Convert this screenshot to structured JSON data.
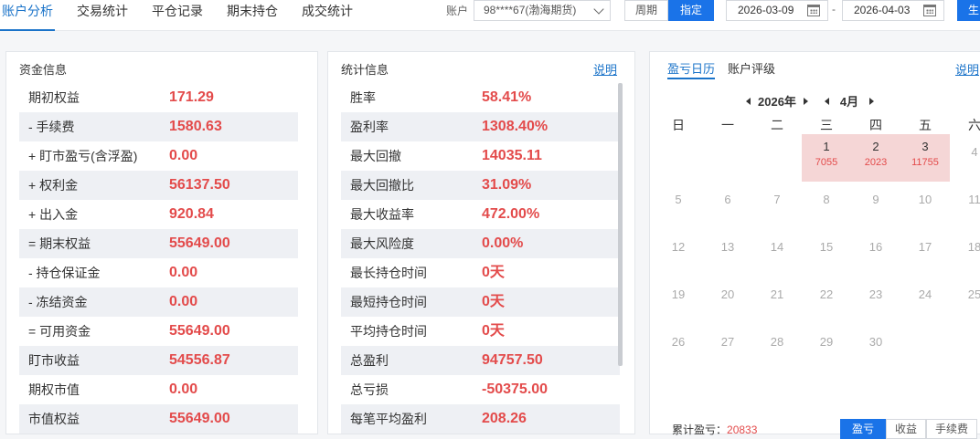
{
  "tabs": [
    "账户分析",
    "交易统计",
    "平仓记录",
    "期末持仓",
    "成交统计"
  ],
  "toolbar": {
    "account_label": "账户",
    "account_value": "98****67(渤海期货)",
    "period_label": "周期",
    "fixed_label": "指定",
    "date_start": "2026-03-09",
    "date_sep": "-",
    "date_end": "2026-04-03",
    "generate_label": "生"
  },
  "funds": {
    "title": "资金信息",
    "rows": [
      {
        "label": "期初权益",
        "value": "171.29"
      },
      {
        "label": "- 手续费",
        "value": "1580.63"
      },
      {
        "label": "+ 盯市盈亏(含浮盈)",
        "value": "0.00"
      },
      {
        "label": "+ 权利金",
        "value": "56137.50"
      },
      {
        "label": "+ 出入金",
        "value": "920.84"
      },
      {
        "label": "= 期末权益",
        "value": "55649.00"
      },
      {
        "label": "- 持仓保证金",
        "value": "0.00"
      },
      {
        "label": "- 冻结资金",
        "value": "0.00"
      },
      {
        "label": "= 可用资金",
        "value": "55649.00"
      },
      {
        "label": "盯市收益",
        "value": "54556.87"
      },
      {
        "label": "期权市值",
        "value": "0.00"
      },
      {
        "label": "市值权益",
        "value": "55649.00"
      }
    ]
  },
  "stats": {
    "title": "统计信息",
    "help": "说明",
    "rows": [
      {
        "label": "胜率",
        "value": "58.41%"
      },
      {
        "label": "盈利率",
        "value": "1308.40%"
      },
      {
        "label": "最大回撤",
        "value": "14035.11"
      },
      {
        "label": "最大回撤比",
        "value": "31.09%"
      },
      {
        "label": "最大收益率",
        "value": "472.00%"
      },
      {
        "label": "最大风险度",
        "value": "0.00%"
      },
      {
        "label": "最长持仓时间",
        "value": "0天"
      },
      {
        "label": "最短持仓时间",
        "value": "0天"
      },
      {
        "label": "平均持仓时间",
        "value": "0天"
      },
      {
        "label": "总盈利",
        "value": "94757.50"
      },
      {
        "label": "总亏损",
        "value": "-50375.00"
      },
      {
        "label": "每笔平均盈利",
        "value": "208.26"
      }
    ]
  },
  "calendar": {
    "tab_active": "盈亏日历",
    "tab_other": "账户评级",
    "help": "说明",
    "year": "2026年",
    "month": "4月",
    "weekdays": [
      "日",
      "一",
      "二",
      "三",
      "四",
      "五",
      "六"
    ],
    "weeks": [
      [
        {
          "d": ""
        },
        {
          "d": ""
        },
        {
          "d": ""
        },
        {
          "d": "1",
          "pnl": "7055"
        },
        {
          "d": "2",
          "pnl": "2023"
        },
        {
          "d": "3",
          "pnl": "11755"
        },
        {
          "d": "4"
        }
      ],
      [
        {
          "d": "5"
        },
        {
          "d": "6"
        },
        {
          "d": "7"
        },
        {
          "d": "8"
        },
        {
          "d": "9"
        },
        {
          "d": "10"
        },
        {
          "d": "11"
        }
      ],
      [
        {
          "d": "12"
        },
        {
          "d": "13"
        },
        {
          "d": "14"
        },
        {
          "d": "15"
        },
        {
          "d": "16"
        },
        {
          "d": "17"
        },
        {
          "d": "18"
        }
      ],
      [
        {
          "d": "19"
        },
        {
          "d": "20"
        },
        {
          "d": "21"
        },
        {
          "d": "22"
        },
        {
          "d": "23"
        },
        {
          "d": "24"
        },
        {
          "d": "25"
        }
      ],
      [
        {
          "d": "26"
        },
        {
          "d": "27"
        },
        {
          "d": "28"
        },
        {
          "d": "29"
        },
        {
          "d": "30"
        },
        {
          "d": ""
        },
        {
          "d": ""
        }
      ]
    ],
    "footer_label": "累计盈亏：",
    "footer_value": "20833",
    "seg_options": [
      "盈亏",
      "收益",
      "手续费"
    ]
  }
}
